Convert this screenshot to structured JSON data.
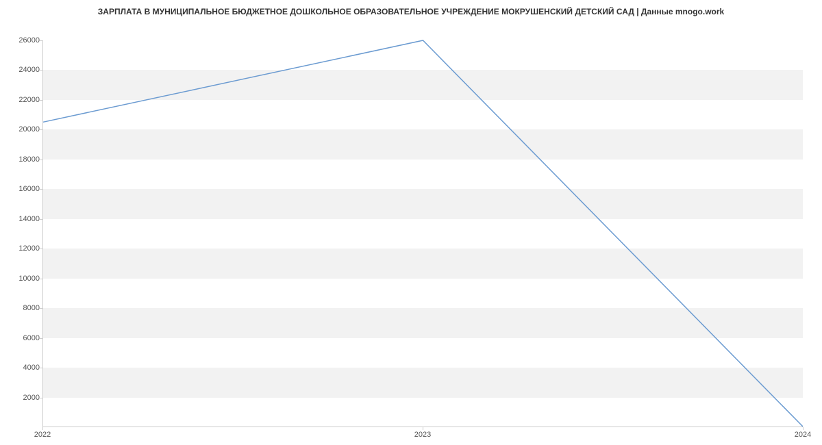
{
  "chart_data": {
    "type": "line",
    "title": "ЗАРПЛАТА В МУНИЦИПАЛЬНОЕ БЮДЖЕТНОЕ ДОШКОЛЬНОЕ ОБРАЗОВАТЕЛЬНОЕ УЧРЕЖДЕНИЕ МОКРУШЕНСКИЙ ДЕТСКИЙ САД | Данные mnogo.work",
    "categories": [
      "2022",
      "2023",
      "2024"
    ],
    "values": [
      20500,
      26000,
      0
    ],
    "xlabel": "",
    "ylabel": "",
    "ylim": [
      0,
      26000
    ],
    "y_ticks": [
      2000,
      4000,
      6000,
      8000,
      10000,
      12000,
      14000,
      16000,
      18000,
      20000,
      22000,
      24000,
      26000
    ],
    "line_color": "#6b9bd1",
    "grid_band_color": "#f2f2f2"
  }
}
